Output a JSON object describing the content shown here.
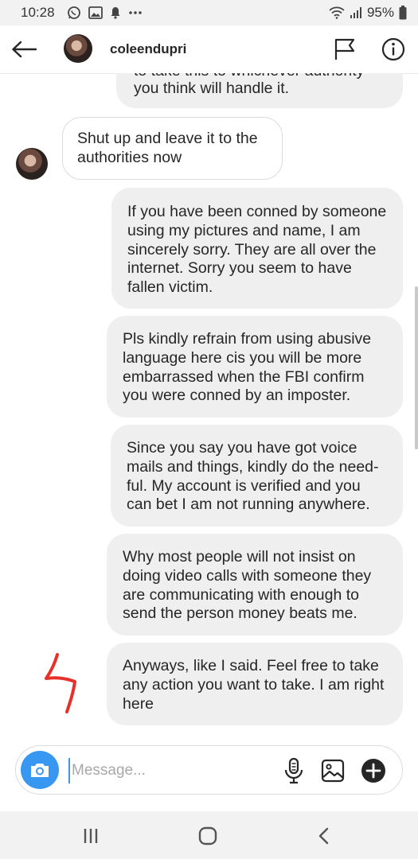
{
  "status_bar": {
    "time": "10:28",
    "battery": "95%"
  },
  "header": {
    "username": "coleendupri"
  },
  "messages": {
    "partial_top_cut": "to take this to whichever authority",
    "partial_top": "you think will handle it.",
    "received": "Shut up and leave it to the authorities now",
    "sent": [
      "If you have been conned by someone using my pictures and name, I am sincerely sorry. They are all over the internet. Sorry you seem to have fallen victim.",
      "Pls kindly refrain from using abusive language here cis you will be more embarrassed when the FBI confirm you were conned by an imposter.",
      "Since you say you have got voice mails and things, kindly do the need-ful. My account is verified and you can bet I am not running anywhere.",
      "Why most people will not insist on doing video calls with someone they are communicating with enough to send the person money beats me.",
      "Anyways, like I said. Feel free to take any action you want to take. I am right here"
    ]
  },
  "composer": {
    "placeholder": "Message..."
  },
  "colors": {
    "accent": "#3897f0",
    "bubble": "#efefef",
    "annotation": "#e8302a"
  },
  "icons": {
    "status_left": [
      "whatsapp-icon",
      "image-icon",
      "notification-icon",
      "more-icon"
    ],
    "status_right": [
      "wifi-icon",
      "signal-icon",
      "battery-icon"
    ],
    "header": [
      "back-arrow-icon",
      "flag-icon",
      "info-icon"
    ],
    "composer": [
      "camera-icon",
      "microphone-icon",
      "gallery-icon",
      "plus-icon"
    ],
    "nav": [
      "recent-apps-icon",
      "home-icon",
      "nav-back-icon"
    ]
  }
}
